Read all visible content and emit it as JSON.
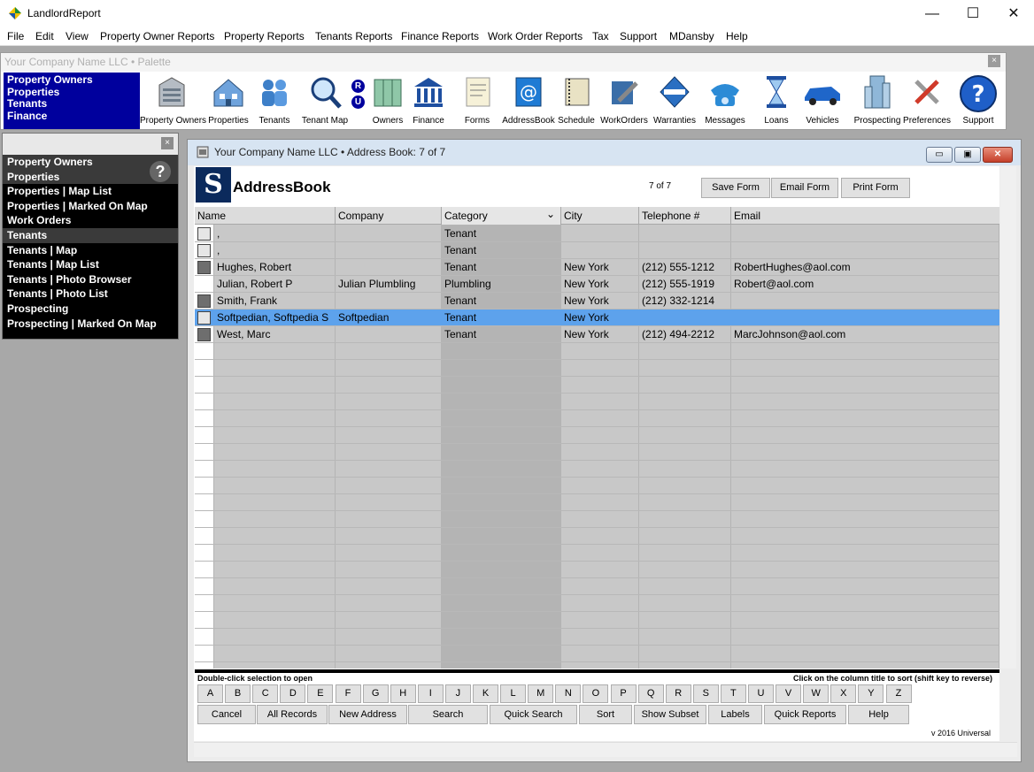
{
  "app": {
    "title": "LandlordReport",
    "minimize": "—",
    "maximize": "☐",
    "close": "✕"
  },
  "menu": [
    "File",
    "Edit",
    "View",
    "Property Owner Reports",
    "Property Reports",
    "Tenants Reports",
    "Finance Reports",
    "Work Order Reports",
    "Tax",
    "Support",
    "MDansby",
    "Help"
  ],
  "palette": {
    "title": "Your Company Name LLC  • Palette",
    "close": "×",
    "nav": [
      "Property Owners",
      "Properties",
      "Tenants",
      "Finance"
    ],
    "ru_letters": [
      "R",
      "U"
    ],
    "tools": [
      {
        "label": "Property Owners",
        "icon": "building-icon"
      },
      {
        "label": "Properties",
        "icon": "house-icon"
      },
      {
        "label": "Tenants",
        "icon": "people-icon"
      },
      {
        "label": "Tenant Map",
        "icon": "magnifier-icon"
      },
      {
        "label": "Owners",
        "icon": "glass-building-icon"
      },
      {
        "label": "Finance",
        "icon": "bank-icon"
      },
      {
        "label": "Forms",
        "icon": "document-icon"
      },
      {
        "label": "AddressBook",
        "icon": "at-book-icon"
      },
      {
        "label": "Schedule",
        "icon": "notebook-icon"
      },
      {
        "label": "WorkOrders",
        "icon": "tools-icon"
      },
      {
        "label": "Warranties",
        "icon": "warranty-badge-icon"
      },
      {
        "label": "Messages",
        "icon": "telephone-icon"
      },
      {
        "label": "Loans",
        "icon": "hourglass-icon"
      },
      {
        "label": "Vehicles",
        "icon": "car-icon"
      },
      {
        "label": "Prospecting",
        "icon": "skyscraper-icon"
      },
      {
        "label": "Preferences",
        "icon": "wrench-screwdriver-icon"
      },
      {
        "label": "Support",
        "icon": "help-icon"
      }
    ]
  },
  "sidebar": {
    "close": "×",
    "help": "?",
    "items": [
      {
        "label": "Property Owners",
        "style": "gray"
      },
      {
        "label": "Properties",
        "style": "gray"
      },
      {
        "label": "Properties | Map List",
        "style": "black"
      },
      {
        "label": "Properties | Marked On Map",
        "style": "black"
      },
      {
        "label": "Work Orders",
        "style": "black"
      },
      {
        "label": "Tenants",
        "style": "gray"
      },
      {
        "label": "Tenants | Map",
        "style": "black"
      },
      {
        "label": "Tenants | Map List",
        "style": "black"
      },
      {
        "label": "Tenants | Photo Browser",
        "style": "black"
      },
      {
        "label": "Tenants | Photo List",
        "style": "black"
      },
      {
        "label": "Prospecting",
        "style": "black"
      },
      {
        "label": "Prospecting | Marked On Map",
        "style": "black"
      }
    ]
  },
  "window": {
    "title": "Your Company Name LLC  •  Address Book: 7 of 7",
    "btn_min": "▭",
    "btn_max": "▣",
    "btn_close": "✕"
  },
  "addressbook": {
    "logo": "S",
    "title": "AddressBook",
    "count": "7  of  7",
    "save_form": "Save Form",
    "email_form": "Email Form",
    "print_form": "Print Form",
    "columns": [
      "Name",
      "Company",
      "Category",
      "City",
      "Telephone #",
      "Email"
    ],
    "sort_arrow": "⌄",
    "rows": [
      {
        "name": ",",
        "company": "",
        "category": "Tenant",
        "city": "",
        "phone": "",
        "email": "",
        "avatar": "placeholder"
      },
      {
        "name": ",",
        "company": "",
        "category": "Tenant",
        "city": "",
        "phone": "",
        "email": "",
        "avatar": "placeholder"
      },
      {
        "name": "Hughes, Robert",
        "company": "",
        "category": "Tenant",
        "city": "New York",
        "phone": "(212) 555-1212",
        "email": "RobertHughes@aol.com",
        "avatar": "photo"
      },
      {
        "name": "Julian, Robert P",
        "company": "Julian Plumbling",
        "category": "Plumbling",
        "city": "New York",
        "phone": "(212) 555-1919",
        "email": "Robert@aol.com",
        "avatar": "none"
      },
      {
        "name": "Smith, Frank",
        "company": "",
        "category": "Tenant",
        "city": "New York",
        "phone": "(212) 332-1214",
        "email": "",
        "avatar": "photo"
      },
      {
        "name": "Softpedian, Softpedia S",
        "company": "Softpedian",
        "category": "Tenant",
        "city": "New York",
        "phone": "",
        "email": "",
        "avatar": "placeholder",
        "selected": true
      },
      {
        "name": "West, Marc",
        "company": "",
        "category": "Tenant",
        "city": "New York",
        "phone": "(212) 494-2212",
        "email": "MarcJohnson@aol.com",
        "avatar": "photo"
      }
    ],
    "hint_left": "Double-click selection to open",
    "hint_right": "Click on the column title to sort (shift key to reverse)",
    "letters": [
      "A",
      "B",
      "C",
      "D",
      "E",
      "F",
      "G",
      "H",
      "I",
      "J",
      "K",
      "L",
      "M",
      "N",
      "O",
      "P",
      "Q",
      "R",
      "S",
      "T",
      "U",
      "V",
      "W",
      "X",
      "Y",
      "Z"
    ],
    "actions": [
      "Cancel",
      "All Records",
      "New Address",
      "Search",
      "Quick Search",
      "Sort",
      "Show Subset",
      "Labels",
      "Quick Reports",
      "Help"
    ],
    "version": "v 2016 Universal"
  },
  "colors": {
    "nav_blue": "#00009d",
    "selection": "#5da2ec",
    "logo_navy": "#0b2a5c"
  }
}
